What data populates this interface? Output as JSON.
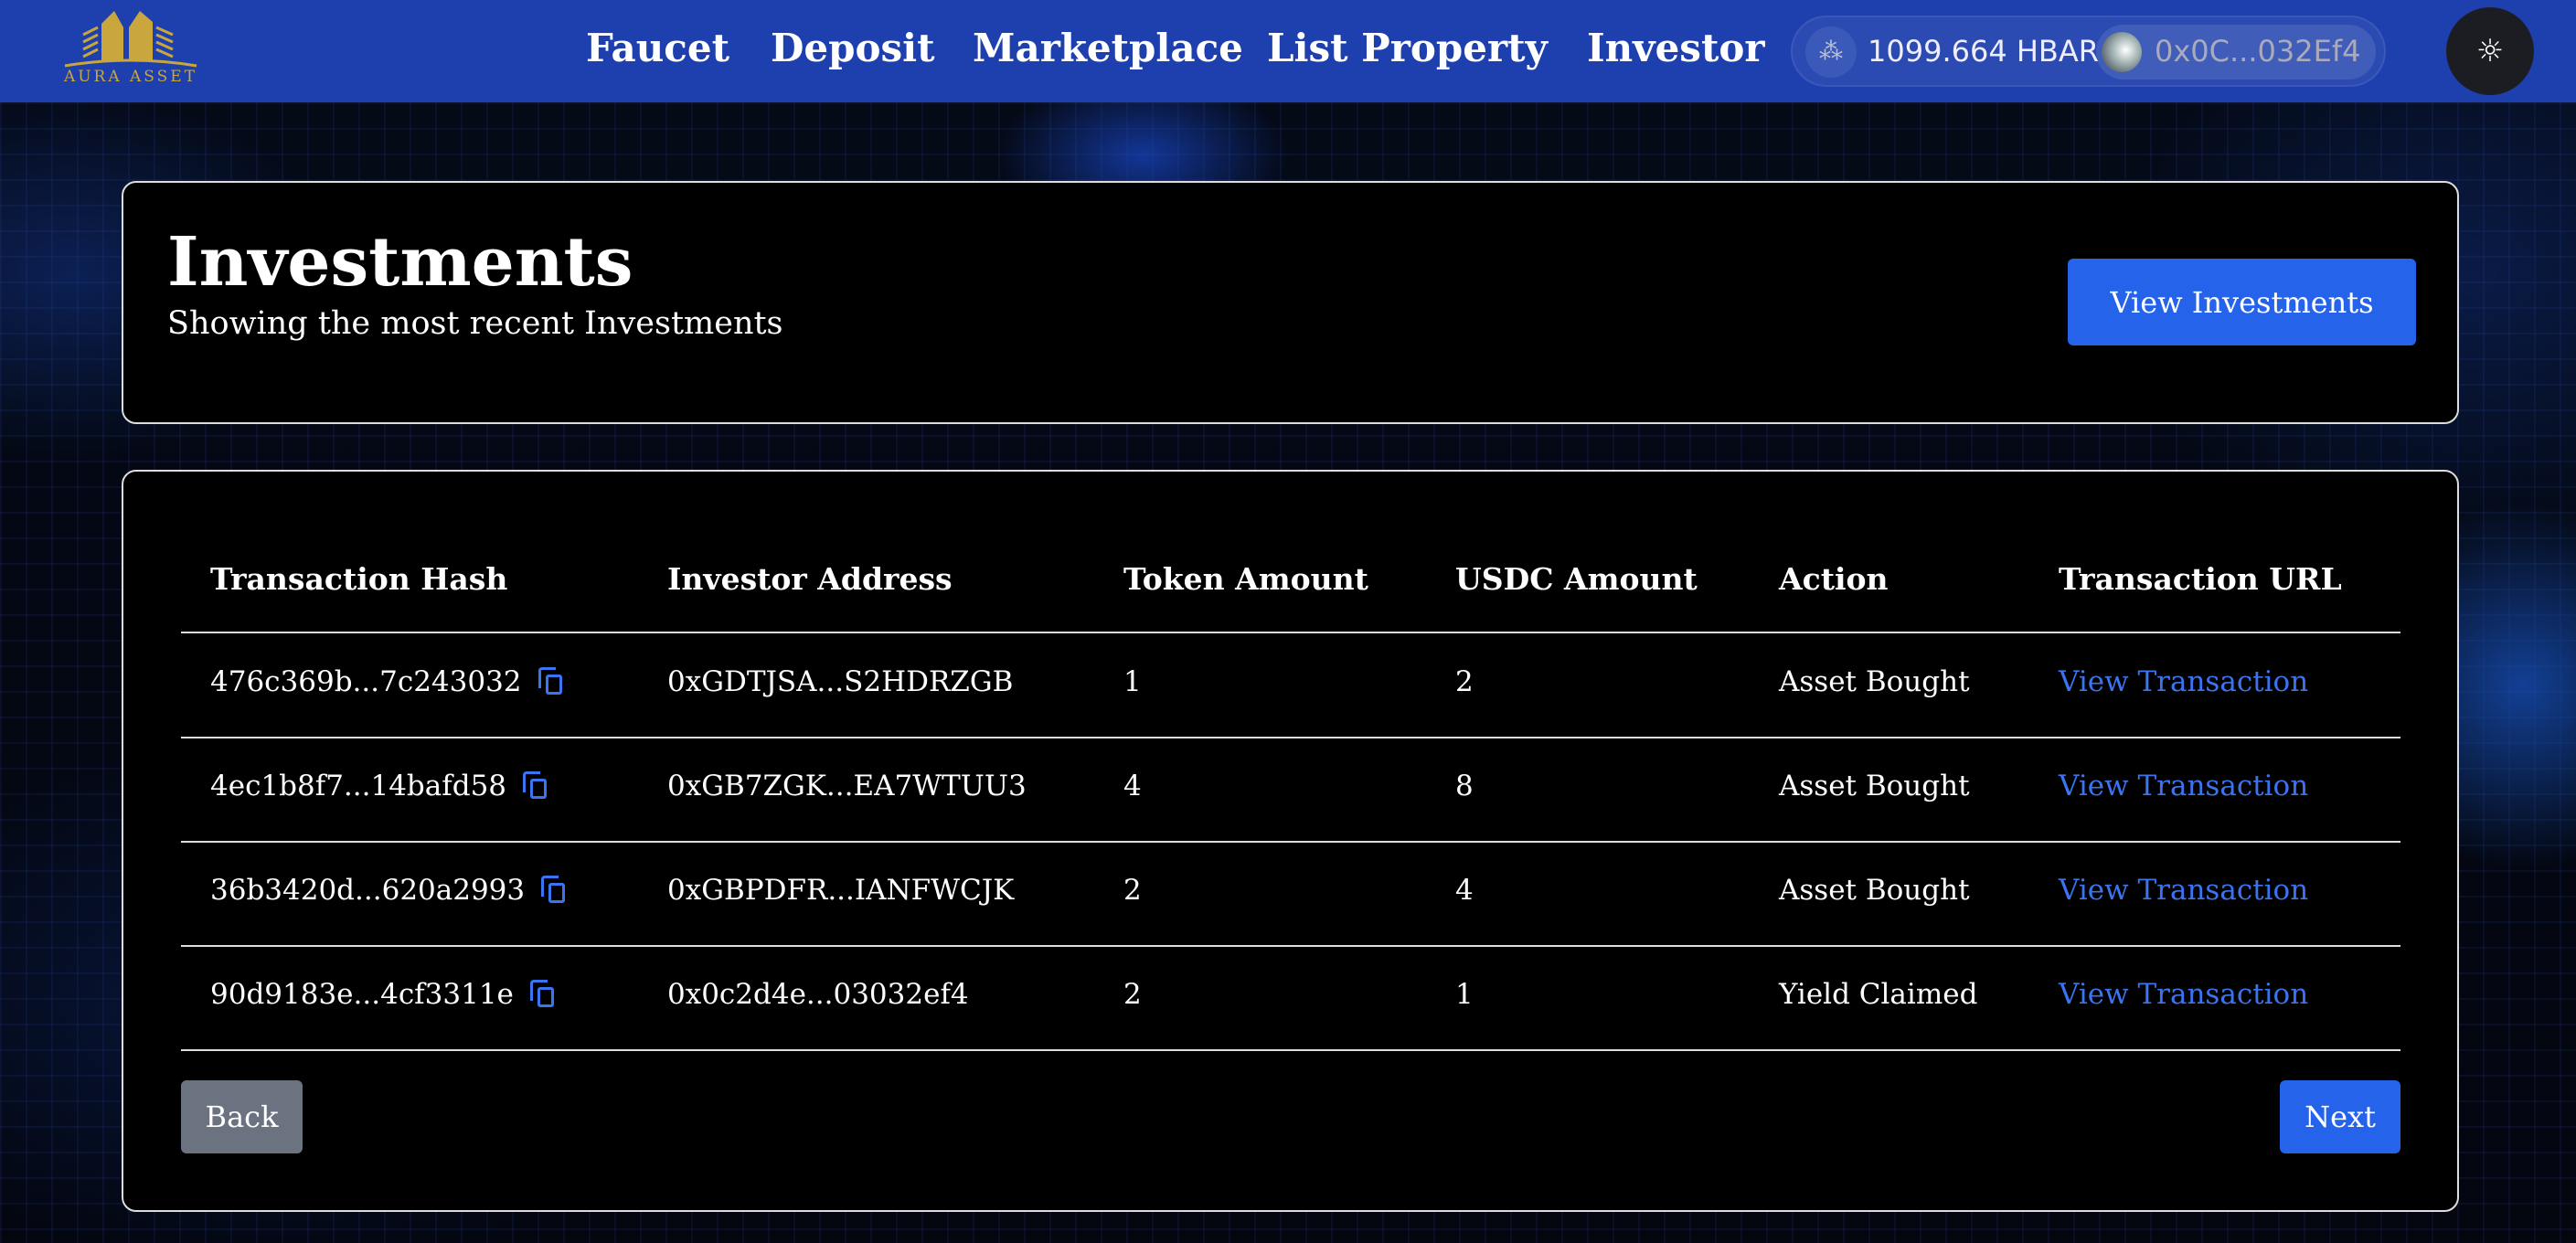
{
  "header": {
    "logo_text": "AURA ASSET",
    "nav": [
      "Faucet",
      "Deposit",
      "Marketplace",
      "List Property",
      "Investor"
    ],
    "balance": "1099.664 HBAR",
    "address": "0x0C...032Ef4",
    "theme_icon": "sun-icon"
  },
  "summary": {
    "title": "Investments",
    "subtitle": "Showing the most recent Investments",
    "button": "View Investments"
  },
  "table": {
    "columns": [
      "Transaction Hash",
      "Investor Address",
      "Token Amount",
      "USDC Amount",
      "Action",
      "Transaction URL"
    ],
    "rows": [
      [
        "476c369b...7c243032",
        "0xGDTJSA...S2HDRZGB",
        "1",
        "2",
        "Asset Bought",
        "View Transaction"
      ],
      [
        "4ec1b8f7...14bafd58",
        "0xGB7ZGK...EA7WTUU3",
        "4",
        "8",
        "Asset Bought",
        "View Transaction"
      ],
      [
        "36b3420d...620a2993",
        "0xGBPDFR...IANFWCJK",
        "2",
        "4",
        "Asset Bought",
        "View Transaction"
      ],
      [
        "90d9183e...4cf3311e",
        "0x0c2d4e...03032ef4",
        "2",
        "1",
        "Yield Claimed",
        "View Transaction"
      ]
    ]
  },
  "pagination": {
    "back": "Back",
    "next": "Next"
  },
  "colors": {
    "header": "#1e40af",
    "accent": "#2563eb",
    "back": "#6b7280"
  }
}
